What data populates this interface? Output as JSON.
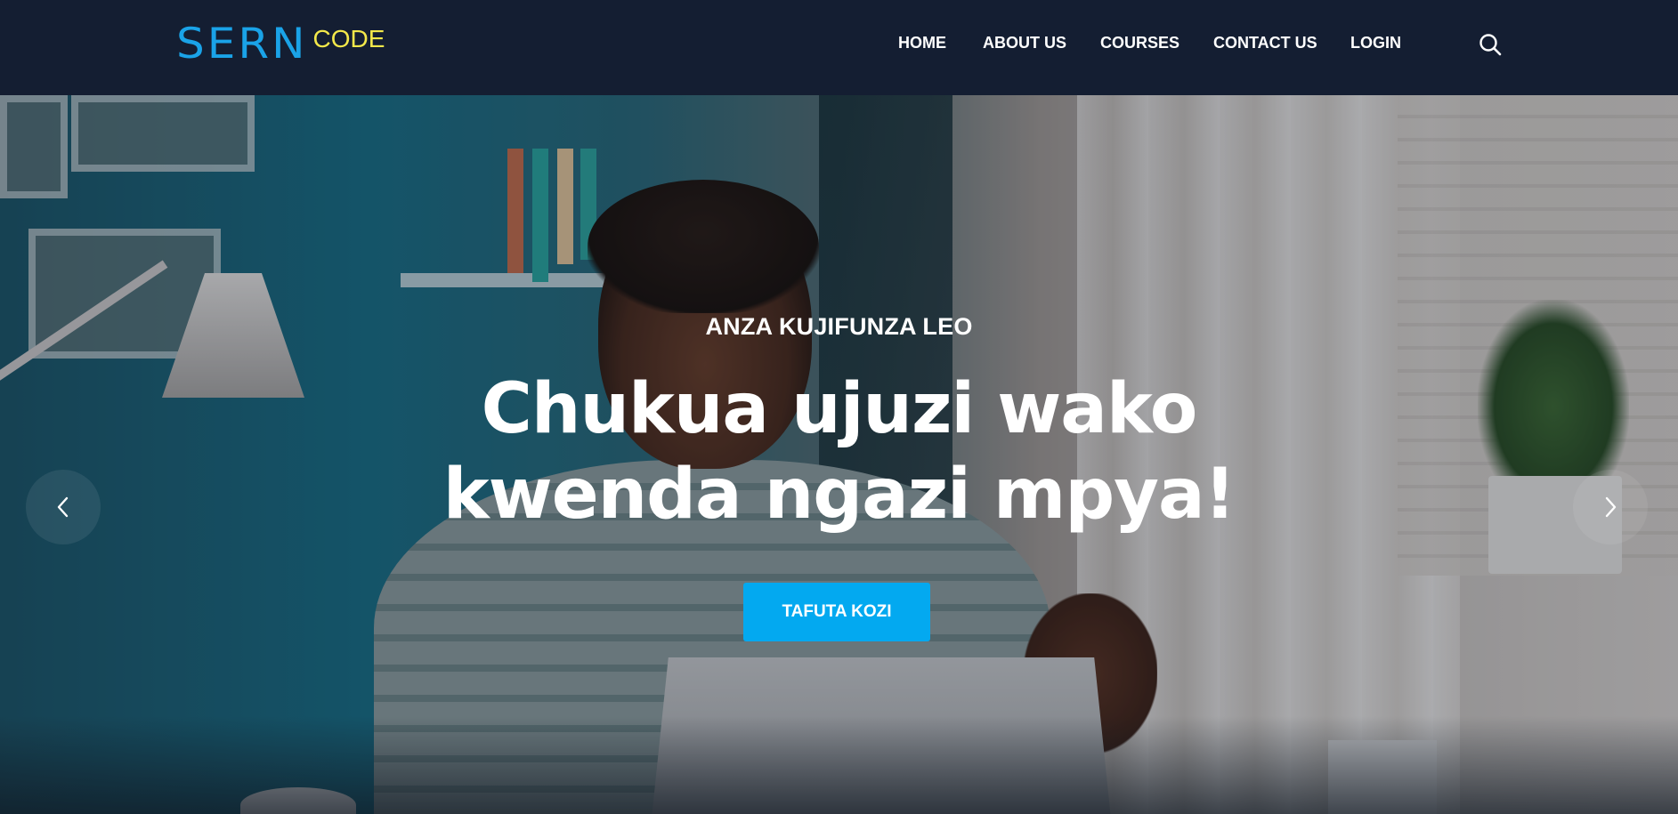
{
  "header": {
    "logo": {
      "mark": "SERN",
      "suffix": "CODE"
    },
    "nav": {
      "home": "HOME",
      "about": "ABOUT US",
      "courses": "COURSES",
      "contact": "CONTACT US",
      "login": "LOGIN"
    },
    "search_icon": "search-icon"
  },
  "hero": {
    "eyebrow": "ANZA KUJIFUNZA LEO",
    "title_line1": "Chukua ujuzi wako",
    "title_line2": "kwenda ngazi mpya!",
    "button_label": "TAFUTA KOZI",
    "prev_icon": "chevron-left-icon",
    "next_icon": "chevron-right-icon"
  },
  "colors": {
    "header_bg": "#141e32",
    "logo_blue": "#1aa3e8",
    "logo_yellow": "#f3e84a",
    "button_bg": "#03a9f0",
    "text": "#ffffff"
  }
}
